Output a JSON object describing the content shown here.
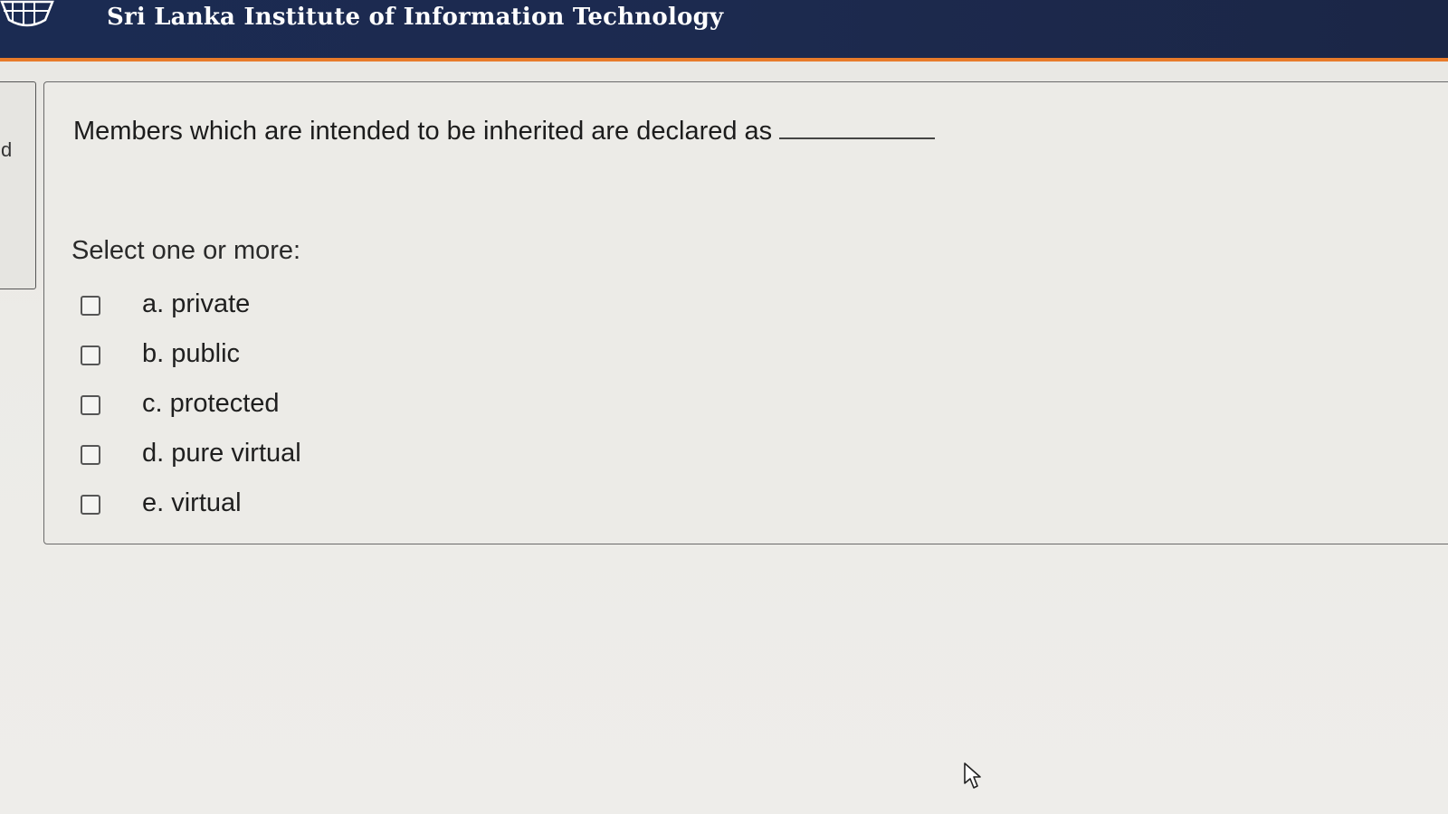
{
  "header": {
    "site_title": "Sri Lanka Institute of Information Technology",
    "accent_color": "#e87b2a",
    "background_color": "#1b2b52",
    "logo_icon": "sliit-crest-icon"
  },
  "left_panel": {
    "text": "d"
  },
  "question": {
    "text": "Members which are intended to be inherited are declared as",
    "prompt": "Select one or more:",
    "options": [
      {
        "label": "a. private",
        "checked": false
      },
      {
        "label": "b. public",
        "checked": false
      },
      {
        "label": "c. protected",
        "checked": false
      },
      {
        "label": "d. pure virtual",
        "checked": false
      },
      {
        "label": "e. virtual",
        "checked": false
      }
    ]
  },
  "cursor_icon": "mouse-pointer-icon"
}
